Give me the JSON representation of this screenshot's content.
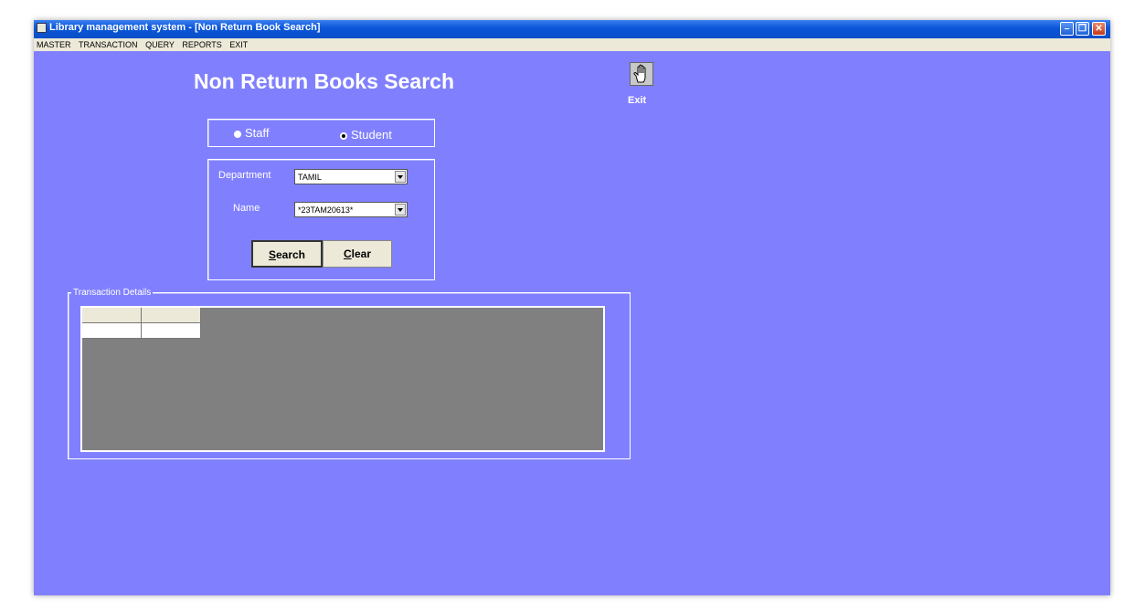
{
  "window": {
    "title": "Library management system - [Non Return Book Search]",
    "controls": {
      "minimize": "–",
      "restore": "❐",
      "close": "✕"
    }
  },
  "menu": [
    "MASTER",
    "TRANSACTION",
    "QUERY",
    "REPORTS",
    "EXIT"
  ],
  "form": {
    "title": "Non Return Books Search",
    "exit_label": "Exit",
    "exit_icon": "hand-icon",
    "member_type": {
      "options": [
        "Staff",
        "Student"
      ],
      "selected": "Student"
    },
    "department": {
      "label": "Department",
      "value": "TAMIL"
    },
    "name": {
      "label": "Name",
      "value": "*23TAM20613*"
    },
    "buttons": {
      "search": {
        "mnemonic": "S",
        "rest": "earch"
      },
      "clear": {
        "mnemonic": "C",
        "rest": "lear"
      }
    },
    "transaction_details": {
      "legend": "Transaction Details",
      "columns": [
        "",
        ""
      ],
      "rows": [
        [
          "",
          ""
        ]
      ]
    }
  },
  "colors": {
    "form_background": "#8080ff",
    "grid_background": "#808080",
    "titlebar": "#0b55d8"
  }
}
